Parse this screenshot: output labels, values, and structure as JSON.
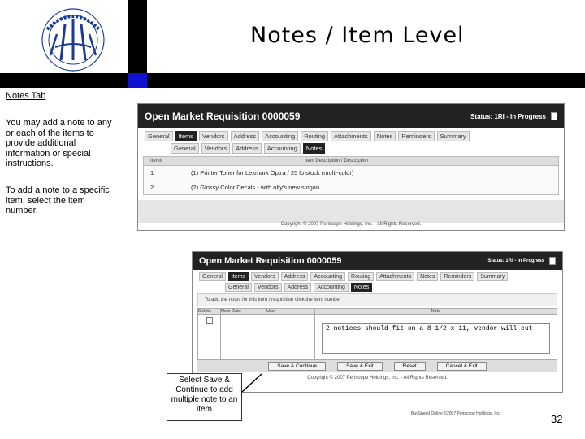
{
  "slide": {
    "title": "Notes / Item Level",
    "page_number": "32",
    "footer": "BuySpeed Online ©2007 Periscope Holdings, Inc."
  },
  "logo": {
    "ring_text": "MEMPHIS-SHELBY COUNTY AIRPORT AUTHORITY"
  },
  "sidebar": {
    "tab_label": "Notes Tab",
    "paragraph1": "You may add a note to any or each of the items to provide additional information or special instructions.",
    "paragraph2": "To add a note to a specific item, select the item number."
  },
  "screen1": {
    "title": "Open Market Requisition 0000059",
    "status": "Status: 1RI - In Progress",
    "tabs": [
      "General",
      "Items",
      "Vendors",
      "Address",
      "Accounting",
      "Routing",
      "Attachments",
      "Notes",
      "Reminders",
      "Summary"
    ],
    "subtabs": [
      "General",
      "Vendors",
      "Address",
      "Accounting",
      "Notes"
    ],
    "grid_header": [
      "Item#",
      "Item Description / Description"
    ],
    "rows": [
      {
        "num": "1",
        "desc": "(1) Printer Toner for Lexmark Optra / 25 lb stock (multi-color)"
      },
      {
        "num": "2",
        "desc": "(2) Glossy Color Decals - with olfy's new slogan"
      }
    ],
    "copyright": "Copyright © 2007 Periscope Holdings, Inc. - All Rights Reserved."
  },
  "screen2": {
    "title": "Open Market Requisition 0000059",
    "status": "Status: 1RI - In Progress",
    "tabs": [
      "General",
      "Items",
      "Vendors",
      "Address",
      "Accounting",
      "Routing",
      "Attachments",
      "Notes",
      "Reminders",
      "Summary"
    ],
    "subtabs": [
      "General",
      "Vendors",
      "Address",
      "Accounting",
      "Notes"
    ],
    "instruction": "To add the notes for this item / requisition click the item number",
    "columns": [
      "Delete",
      "Note Date",
      "User",
      "Note"
    ],
    "note_text": "2 notices should fit on a 8 1/2 x 11, vendor will cut",
    "buttons": [
      "Save & Continue",
      "Save & Exit",
      "Reset",
      "Cancel & Exit"
    ],
    "copyright": "Copyright © 2007 Periscope Holdings, Inc. - All Rights Reserved."
  },
  "callout": {
    "text": "Select Save & Continue to add multiple note to an item"
  }
}
